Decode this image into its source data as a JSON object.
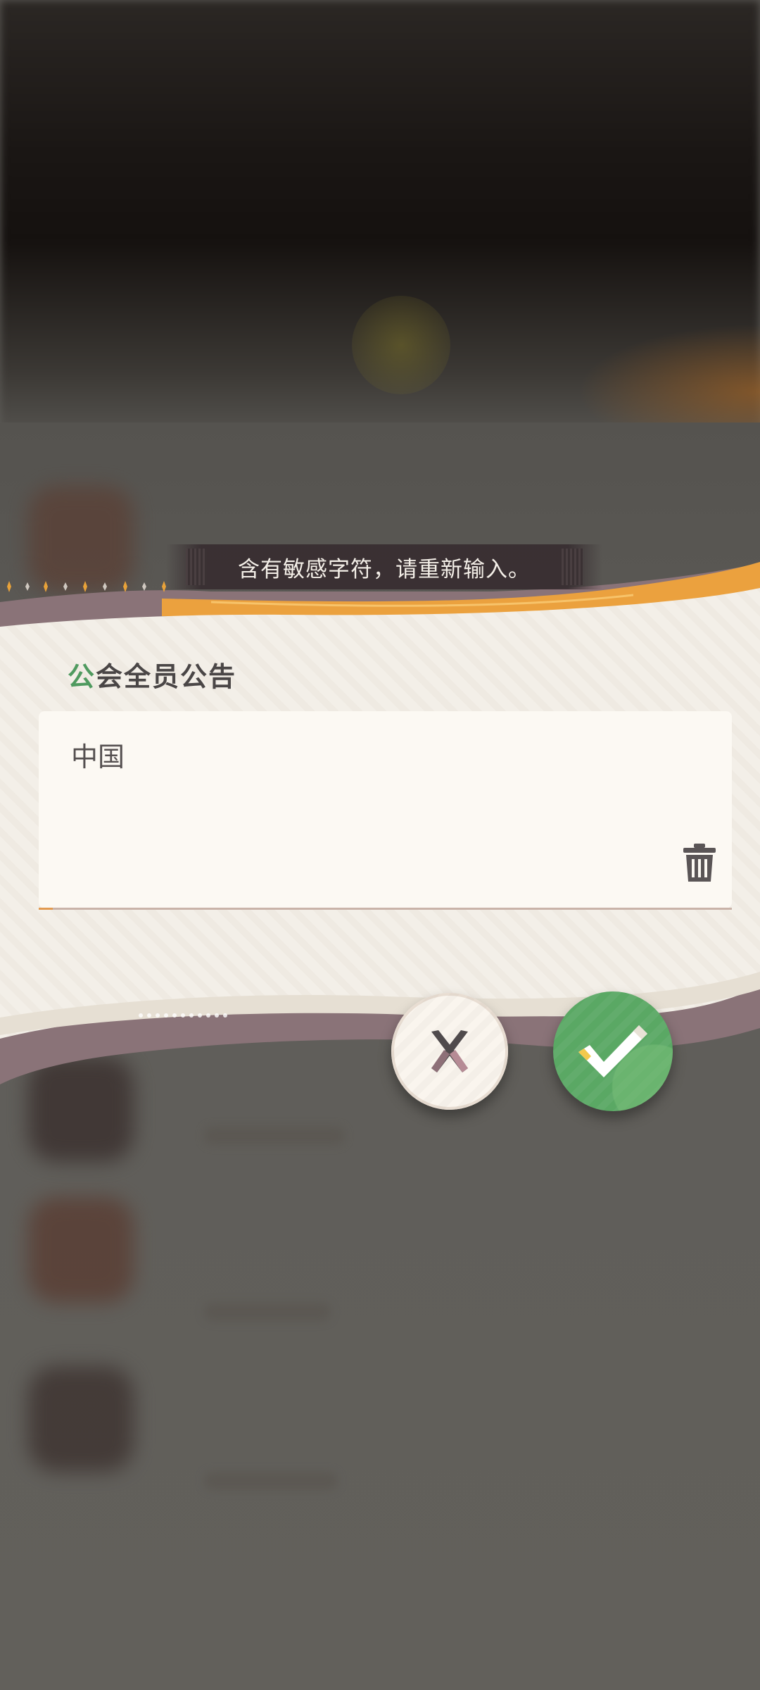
{
  "toast": {
    "message": "含有敏感字符，请重新输入。"
  },
  "dialog": {
    "title_first_char": "公",
    "title_rest": "会全员公告",
    "input": {
      "value": "中国"
    },
    "icons": {
      "clear": "trash-icon",
      "cancel": "cross-icon",
      "confirm": "check-icon"
    }
  },
  "colors": {
    "accent_green": "#4f9a5f",
    "confirm_green": "#5aa864",
    "accent_orange": "#eba13e",
    "mauve_band": "#8a7378",
    "panel_cream": "#f3efe8"
  }
}
